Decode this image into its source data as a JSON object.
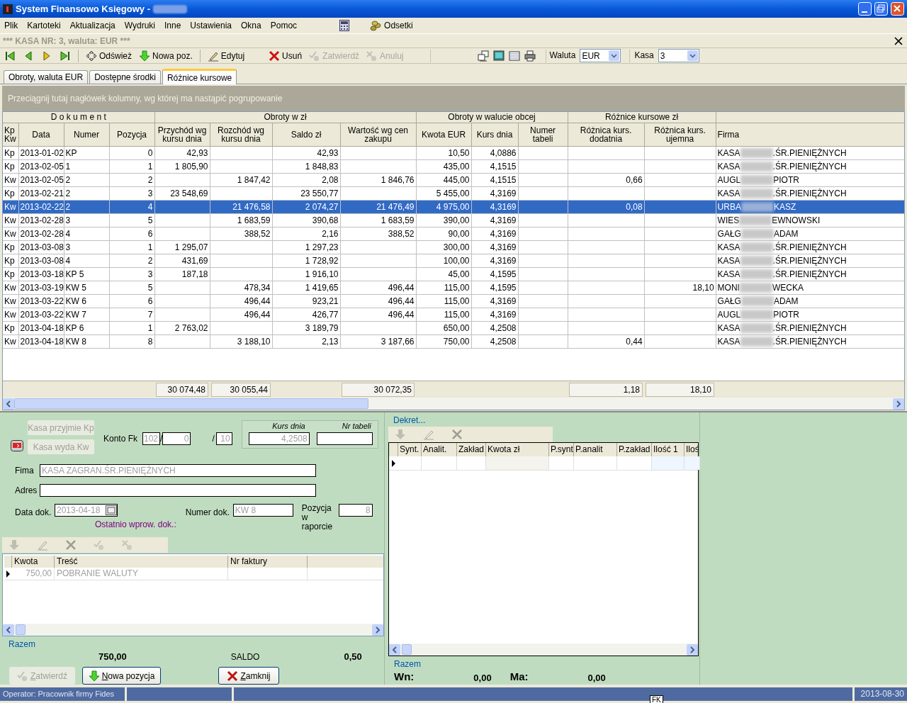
{
  "window": {
    "title": "System Finansowo Księgowy -"
  },
  "menu": [
    "Plik",
    "Kartoteki",
    "Aktualizacja",
    "Wydruki",
    "Inne",
    "Ustawienia",
    "Okna",
    "Pomoc"
  ],
  "menu_tool": "Odsetki",
  "kasa_banner": "*** KASA NR: 3, waluta: EUR ***",
  "toolbar": [
    {
      "kind": "first"
    },
    {
      "kind": "prev"
    },
    {
      "kind": "next"
    },
    {
      "kind": "last"
    },
    {
      "kind": "refresh",
      "label": "Odśwież",
      "disabled": false
    },
    {
      "kind": "new",
      "label": "Nowa poz.",
      "disabled": false
    },
    {
      "kind": "edit",
      "label": "Edytuj",
      "disabled": false
    },
    {
      "kind": "delete",
      "label": "Usuń",
      "disabled": false
    },
    {
      "kind": "approve",
      "label": "Zatwierdź",
      "disabled": true
    },
    {
      "kind": "cancel",
      "label": "Anuluj",
      "disabled": true
    }
  ],
  "waluta": {
    "label": "Waluta",
    "value": "EUR"
  },
  "kasa": {
    "label": "Kasa",
    "value": "3"
  },
  "tabs": [
    {
      "label": "Obroty, waluta EUR",
      "selected": false
    },
    {
      "label": "Dostępne środki",
      "selected": false
    },
    {
      "label": "Różnice kursowe",
      "selected": true
    }
  ],
  "group_hint": "Przeciągnij tutaj nagłówek kolumny, wg której ma nastąpić pogrupowanie",
  "groups": [
    {
      "label": "D o k u m e n t",
      "columns": [
        "Kp Kw",
        "Data",
        "Numer",
        "Pozycja"
      ]
    },
    {
      "label": "Obroty w zł",
      "columns": [
        "Przychód wg kursu dnia",
        "Rozchód wg kursu dnia",
        "Saldo zł",
        "Wartość wg  cen zakupu"
      ]
    },
    {
      "label": "Obroty w walucie obcej",
      "columns": [
        "Kwota EUR",
        "Kurs dnia",
        "Numer tabeli"
      ]
    },
    {
      "label": "Różnice kursowe zł",
      "columns": [
        "Różnica kurs. dodatnia",
        "Różnica kurs. ujemna"
      ]
    },
    {
      "columns": [
        "Firma"
      ]
    }
  ],
  "rows": [
    {
      "selected": false,
      "cells": [
        "Kp",
        "2013-01-02",
        "KP",
        "0",
        "42,93",
        null,
        "42,93",
        null,
        "10,50",
        "4,0886",
        null,
        null,
        null
      ],
      "firma": [
        "KASA",
        ".ŚR.PIENIĘŻNYCH"
      ]
    },
    {
      "selected": false,
      "cells": [
        "Kp",
        "2013-02-05",
        "1",
        "1",
        "1 805,90",
        null,
        "1 848,83",
        null,
        "435,00",
        "4,1515",
        null,
        null,
        null
      ],
      "firma": [
        "KASA",
        ".ŚR.PIENIĘŻNYCH"
      ]
    },
    {
      "selected": false,
      "cells": [
        "Kw",
        "2013-02-05",
        "2",
        "2",
        null,
        "1 847,42",
        "2,08",
        "1 846,76",
        "445,00",
        "4,1515",
        null,
        "0,66",
        null
      ],
      "firma": [
        "AUGL",
        "PIOTR"
      ]
    },
    {
      "selected": false,
      "cells": [
        "Kp",
        "2013-02-21",
        "2",
        "3",
        "23 548,69",
        null,
        "23 550,77",
        null,
        "5 455,00",
        "4,3169",
        null,
        null,
        null
      ],
      "firma": [
        "KASA",
        ".ŚR.PIENIĘŻNYCH"
      ]
    },
    {
      "selected": true,
      "cells": [
        "Kw",
        "2013-02-22",
        "2",
        "4",
        null,
        "21 476,58",
        "2 074,27",
        "21 476,49",
        "4 975,00",
        "4,3169",
        null,
        "0,08",
        null
      ],
      "firma": [
        "URBA",
        "KASZ"
      ]
    },
    {
      "selected": false,
      "cells": [
        "Kw",
        "2013-02-28",
        "3",
        "5",
        null,
        "1 683,59",
        "390,68",
        "1 683,59",
        "390,00",
        "4,3169",
        null,
        null,
        null
      ],
      "firma": [
        "WIES",
        "EWNOWSKI"
      ]
    },
    {
      "selected": false,
      "cells": [
        "Kw",
        "2013-02-28",
        "4",
        "6",
        null,
        "388,52",
        "2,16",
        "388,52",
        "90,00",
        "4,3169",
        null,
        null,
        null
      ],
      "firma": [
        "GAŁG",
        "ADAM"
      ]
    },
    {
      "selected": false,
      "cells": [
        "Kp",
        "2013-03-08",
        "3",
        "1",
        "1 295,07",
        null,
        "1 297,23",
        null,
        "300,00",
        "4,3169",
        null,
        null,
        null
      ],
      "firma": [
        "KASA",
        ".ŚR.PIENIĘŻNYCH"
      ]
    },
    {
      "selected": false,
      "cells": [
        "Kp",
        "2013-03-08",
        "4",
        "2",
        "431,69",
        null,
        "1 728,92",
        null,
        "100,00",
        "4,3169",
        null,
        null,
        null
      ],
      "firma": [
        "KASA",
        ".ŚR.PIENIĘŻNYCH"
      ]
    },
    {
      "selected": false,
      "cells": [
        "Kp",
        "2013-03-18",
        "KP 5",
        "3",
        "187,18",
        null,
        "1 916,10",
        null,
        "45,00",
        "4,1595",
        null,
        null,
        null
      ],
      "firma": [
        "KASA",
        ".ŚR.PIENIĘŻNYCH"
      ]
    },
    {
      "selected": false,
      "cells": [
        "Kw",
        "2013-03-19",
        "KW 5",
        "5",
        null,
        "478,34",
        "1 419,65",
        "496,44",
        "115,00",
        "4,1595",
        null,
        null,
        "18,10"
      ],
      "firma": [
        "MONI",
        "WECKA"
      ]
    },
    {
      "selected": false,
      "cells": [
        "Kw",
        "2013-03-22",
        "KW 6",
        "6",
        null,
        "496,44",
        "923,21",
        "496,44",
        "115,00",
        "4,3169",
        null,
        null,
        null
      ],
      "firma": [
        "GAŁG",
        "ADAM"
      ]
    },
    {
      "selected": false,
      "cells": [
        "Kw",
        "2013-03-22",
        "KW 7",
        "7",
        null,
        "496,44",
        "426,77",
        "496,44",
        "115,00",
        "4,3169",
        null,
        null,
        null
      ],
      "firma": [
        "AUGL",
        "PIOTR"
      ]
    },
    {
      "selected": false,
      "cells": [
        "Kp",
        "2013-04-18",
        "KP 6",
        "1",
        "2 763,02",
        null,
        "3 189,79",
        null,
        "650,00",
        "4,2508",
        null,
        null,
        null
      ],
      "firma": [
        "KASA",
        ".ŚR.PIENIĘŻNYCH"
      ]
    },
    {
      "selected": false,
      "cells": [
        "Kw",
        "2013-04-18",
        "KW 8",
        "8",
        null,
        "3 188,10",
        "2,13",
        "3 187,66",
        "750,00",
        "4,2508",
        null,
        "0,44",
        null
      ],
      "firma": [
        "KASA",
        ".ŚR.PIENIĘŻNYCH"
      ]
    }
  ],
  "totals": {
    "przychod": "30 074,48",
    "rozchod": "30 055,44",
    "wartosc": "30 072,35",
    "roznica_dodatnia": "1,18",
    "roznica_ujemna": "18,10"
  },
  "form": {
    "kp_button": "Kasa przyjmie  Kp",
    "kw_button": "Kasa wyda  Kw",
    "konto_label": "Konto Fk",
    "konto": [
      "102",
      "0",
      "10"
    ],
    "konto_separators": [
      "/",
      "/"
    ],
    "kurs_label": "Kurs dnia",
    "kurs": "4,2508",
    "nr_tabeli_label": "Nr tabeli",
    "firma_label": "Fima",
    "firma": "KASA ZAGRAN.ŚR.PIENIĘŻNYCH",
    "adres_label": "Adres",
    "data_label": "Data dok.",
    "data": "2013-04-18",
    "numer_label": "Numer dok.",
    "numer": "KW 8",
    "pozycja_label": "Pozycja w raporcie",
    "pozycja": "8",
    "last_doc": "Ostatnio wprow. dok.:"
  },
  "items": {
    "columns": [
      "Kwota",
      "Treść",
      "Nr faktury"
    ],
    "rows": [
      {
        "cells": [
          "750,00",
          "POBRANIE WALUTY"
        ]
      }
    ]
  },
  "summary": {
    "razem": "Razem",
    "total": "750,00",
    "saldo_label": "SALDO",
    "saldo": "0,50"
  },
  "actions": [
    {
      "kind": "approve",
      "label": "Zatwierdź",
      "disabled": true
    },
    {
      "kind": "new",
      "label": "Nowa pozycja",
      "disabled": false
    },
    {
      "kind": "close",
      "label": "Zamknij",
      "disabled": false
    }
  ],
  "dekret": {
    "title": "Dekret...",
    "columns": [
      "Synt.",
      "Analit.",
      "Zakład",
      "Kwota zł",
      "P.synt",
      "P.analit",
      "P.zakład",
      "Ilość 1",
      "Iloś"
    ],
    "razem": "Razem",
    "wn_label": "Wn:",
    "wn": "0,00",
    "ma_label": "Ma:",
    "ma": "0,00"
  },
  "status_bar": {
    "operator": "Operator: Pracownik firmy Fides",
    "date": "2013-08-30"
  },
  "tooltip": "FK"
}
